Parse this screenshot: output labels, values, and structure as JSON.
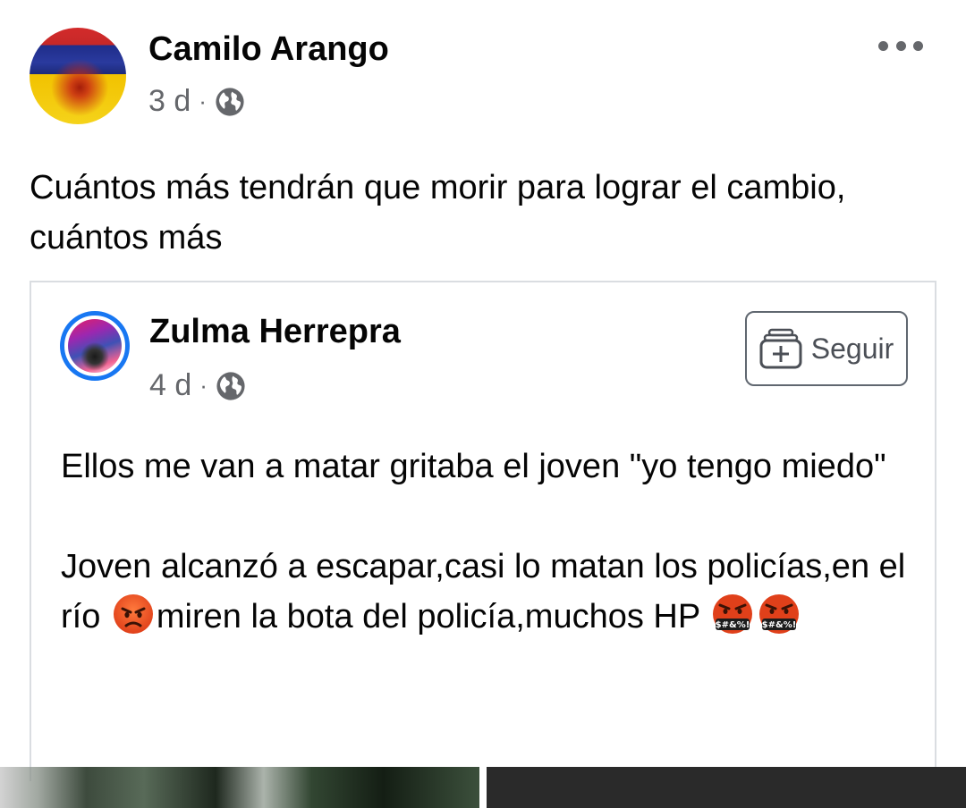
{
  "post": {
    "author": "Camilo Arango",
    "time": "3 d",
    "separator": "·",
    "privacy_icon": "globe-icon",
    "more_icon": "more-options-icon",
    "text": "Cuántos más tendrán que morir para lograr el cambio, cuántos más"
  },
  "shared": {
    "author": "Zulma Herrepra",
    "time": "4 d",
    "separator": "·",
    "privacy_icon": "globe-icon",
    "follow_label": "Seguir",
    "follow_icon": "follow-plus-icon",
    "paragraph1": "Ellos me van a matar gritaba el joven \"yo tengo miedo\"",
    "paragraph2_part1": "Joven alcanzó a escapar,casi lo matan los policías,en el río ",
    "paragraph2_part2": "miren  la bota del policía,muchos HP ",
    "emojis": [
      "angry-face",
      "face-with-symbols-on-mouth",
      "face-with-symbols-on-mouth"
    ]
  },
  "colors": {
    "text": "#050505",
    "meta": "#65676b",
    "avatar_ring": "#1877f2",
    "card_border": "#dadde1"
  }
}
